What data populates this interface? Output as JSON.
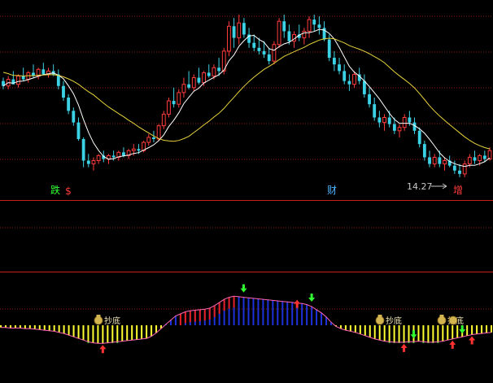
{
  "colors": {
    "background": "#000000",
    "grid": "#8c1a1a",
    "separator": "#c81e1e",
    "up_candle": "#ff3c3c",
    "down_candle": "#3cd2e6",
    "ma_short": "#ffffff",
    "ma_long": "#e6d23c",
    "hist_red": "#e61e1e",
    "hist_blue": "#1e32dc",
    "hist_yellow": "#ffff32",
    "hist_green": "#32dc32",
    "pink_line": "#ff64b4",
    "arrow_up": "#ff3232",
    "arrow_down": "#32ff32",
    "bag": "#d2b450"
  },
  "chart_data": [
    {
      "type": "candlestick",
      "title": "",
      "annotations": [
        {
          "text": "跌",
          "color": "#32ff32"
        },
        {
          "text": "$",
          "color": "#ff3c3c"
        },
        {
          "text": "财",
          "color": "#50b4ff"
        },
        {
          "text": "增",
          "color": "#ff3c3c"
        }
      ],
      "low_marker": {
        "text": "14.27",
        "value": 14.27
      },
      "series": [
        {
          "name": "",
          "kind": "ma_short"
        },
        {
          "name": "",
          "kind": "ma_long"
        }
      ],
      "ohlc": [
        [
          60,
          62,
          55,
          57
        ],
        [
          57,
          63,
          55,
          61
        ],
        [
          61,
          66,
          58,
          58
        ],
        [
          58,
          64,
          56,
          63
        ],
        [
          63,
          68,
          60,
          61
        ],
        [
          61,
          66,
          59,
          65
        ],
        [
          65,
          70,
          62,
          63
        ],
        [
          63,
          68,
          61,
          67
        ],
        [
          67,
          71,
          64,
          64
        ],
        [
          64,
          68,
          62,
          66
        ],
        [
          66,
          70,
          63,
          64
        ],
        [
          64,
          67,
          55,
          57
        ],
        [
          57,
          60,
          48,
          50
        ],
        [
          50,
          52,
          40,
          42
        ],
        [
          42,
          44,
          33,
          35
        ],
        [
          35,
          38,
          24,
          25
        ],
        [
          25,
          26,
          8,
          12
        ],
        [
          12,
          16,
          8,
          10
        ],
        [
          10,
          14,
          6,
          12
        ],
        [
          12,
          16,
          10,
          15
        ],
        [
          15,
          18,
          11,
          13
        ],
        [
          13,
          16,
          10,
          15
        ],
        [
          15,
          18,
          12,
          14
        ],
        [
          14,
          18,
          12,
          17
        ],
        [
          17,
          20,
          14,
          15
        ],
        [
          15,
          19,
          13,
          18
        ],
        [
          18,
          22,
          15,
          19
        ],
        [
          19,
          22,
          16,
          18
        ],
        [
          18,
          24,
          17,
          23
        ],
        [
          23,
          28,
          21,
          26
        ],
        [
          26,
          30,
          23,
          25
        ],
        [
          25,
          34,
          24,
          33
        ],
        [
          33,
          42,
          31,
          40
        ],
        [
          40,
          50,
          38,
          48
        ],
        [
          48,
          56,
          44,
          46
        ],
        [
          46,
          55,
          44,
          53
        ],
        [
          53,
          62,
          50,
          58
        ],
        [
          58,
          66,
          55,
          56
        ],
        [
          56,
          64,
          54,
          62
        ],
        [
          62,
          68,
          58,
          59
        ],
        [
          59,
          66,
          57,
          65
        ],
        [
          65,
          70,
          62,
          63
        ],
        [
          63,
          70,
          61,
          68
        ],
        [
          68,
          74,
          63,
          66
        ],
        [
          66,
          80,
          64,
          78
        ],
        [
          78,
          96,
          75,
          93
        ],
        [
          93,
          98,
          80,
          86
        ],
        [
          86,
          100,
          82,
          95
        ],
        [
          95,
          98,
          86,
          88
        ],
        [
          88,
          92,
          80,
          83
        ],
        [
          83,
          88,
          78,
          80
        ],
        [
          80,
          86,
          76,
          78
        ],
        [
          78,
          84,
          74,
          76
        ],
        [
          76,
          80,
          70,
          72
        ],
        [
          72,
          84,
          70,
          82
        ],
        [
          82,
          98,
          80,
          96
        ],
        [
          96,
          100,
          86,
          90
        ],
        [
          90,
          94,
          82,
          84
        ],
        [
          84,
          90,
          80,
          88
        ],
        [
          88,
          94,
          84,
          86
        ],
        [
          86,
          92,
          82,
          90
        ],
        [
          90,
          99,
          86,
          97
        ],
        [
          97,
          100,
          90,
          94
        ],
        [
          94,
          99,
          88,
          92
        ],
        [
          92,
          96,
          84,
          85
        ],
        [
          85,
          88,
          72,
          74
        ],
        [
          74,
          78,
          66,
          70
        ],
        [
          70,
          74,
          64,
          66
        ],
        [
          66,
          70,
          58,
          60
        ],
        [
          60,
          64,
          54,
          58
        ],
        [
          58,
          66,
          56,
          64
        ],
        [
          64,
          68,
          58,
          60
        ],
        [
          60,
          64,
          50,
          52
        ],
        [
          52,
          56,
          44,
          46
        ],
        [
          46,
          50,
          36,
          38
        ],
        [
          38,
          42,
          32,
          35
        ],
        [
          35,
          40,
          30,
          38
        ],
        [
          38,
          42,
          32,
          34
        ],
        [
          34,
          38,
          28,
          30
        ],
        [
          30,
          34,
          26,
          32
        ],
        [
          32,
          40,
          30,
          38
        ],
        [
          38,
          42,
          33,
          35
        ],
        [
          35,
          38,
          28,
          30
        ],
        [
          30,
          32,
          20,
          22
        ],
        [
          22,
          24,
          12,
          14
        ],
        [
          14,
          18,
          8,
          10
        ],
        [
          10,
          16,
          8,
          14
        ],
        [
          14,
          18,
          8,
          10
        ],
        [
          10,
          14,
          6,
          12
        ],
        [
          12,
          15,
          8,
          9
        ],
        [
          9,
          12,
          4,
          6
        ],
        [
          6,
          10,
          2,
          4
        ],
        [
          4,
          12,
          2,
          10
        ],
        [
          10,
          16,
          8,
          14
        ],
        [
          14,
          18,
          10,
          12
        ],
        [
          12,
          16,
          9,
          15
        ],
        [
          15,
          18,
          11,
          13
        ],
        [
          13,
          20,
          12,
          18
        ]
      ]
    },
    {
      "type": "bar",
      "title": "",
      "annotations": [
        {
          "text": "抄底",
          "icon": "money-bag-icon"
        },
        {
          "text": "抄底",
          "icon": "money-bag-icon"
        },
        {
          "text": "抄底",
          "icon": "money-bag-icon"
        }
      ],
      "values": [
        -4,
        -4,
        -5,
        -5,
        -5,
        -6,
        -6,
        -7,
        -8,
        -9,
        -10,
        -11,
        -13,
        -15,
        -18,
        -21,
        -24,
        -27,
        -30,
        -32,
        -33,
        -33,
        -32,
        -31,
        -30,
        -29,
        -28,
        -27,
        -26,
        -25,
        -24,
        -20,
        -14,
        -6,
        2,
        10,
        18,
        22,
        26,
        28,
        29,
        30,
        31,
        33,
        38,
        44,
        50,
        54,
        56,
        55,
        54,
        53,
        52,
        51,
        50,
        49,
        48,
        47,
        46,
        45,
        44,
        43,
        42,
        40,
        36,
        30,
        24,
        16,
        6,
        -2,
        -6,
        -9,
        -11,
        -13,
        -16,
        -19,
        -22,
        -25,
        -27,
        -29,
        -30,
        -31,
        -31,
        -31,
        -30,
        -30,
        -29,
        -30,
        -31,
        -31,
        -30,
        -29,
        -27,
        -25,
        -23,
        -21,
        -19,
        -17,
        -16,
        -15,
        -14,
        -13
      ],
      "signals": [
        {
          "type": "up",
          "index": 21
        },
        {
          "type": "down",
          "index": 50
        },
        {
          "type": "up",
          "index": 61
        },
        {
          "type": "down",
          "index": 64
        },
        {
          "type": "down",
          "index": 85
        },
        {
          "type": "up",
          "index": 83
        },
        {
          "type": "up",
          "index": 93
        },
        {
          "type": "down",
          "index": 95
        },
        {
          "type": "up",
          "index": 97
        }
      ]
    }
  ]
}
